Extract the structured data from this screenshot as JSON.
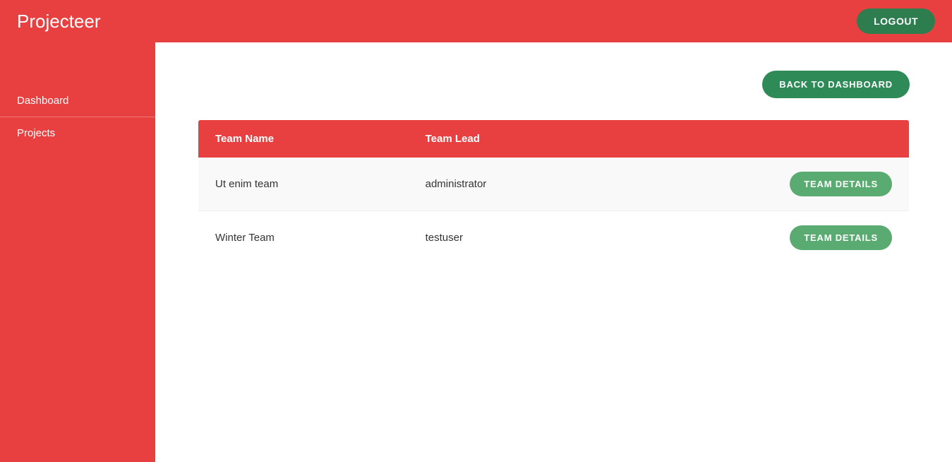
{
  "app": {
    "title": "Projecteer"
  },
  "header": {
    "logout_label": "LOGOUT"
  },
  "sidebar": {
    "items": [
      {
        "label": "Dashboard",
        "id": "dashboard"
      },
      {
        "label": "Projects",
        "id": "projects"
      }
    ]
  },
  "content": {
    "back_button_label": "BACK TO DASHBOARD",
    "table": {
      "columns": [
        {
          "label": "Team Name"
        },
        {
          "label": "Team Lead"
        },
        {
          "label": ""
        }
      ],
      "rows": [
        {
          "team_name": "Ut enim team",
          "team_lead": "administrator",
          "button_label": "TEAM DETAILS"
        },
        {
          "team_name": "Winter Team",
          "team_lead": "testuser",
          "button_label": "TEAM DETAILS"
        }
      ]
    }
  }
}
